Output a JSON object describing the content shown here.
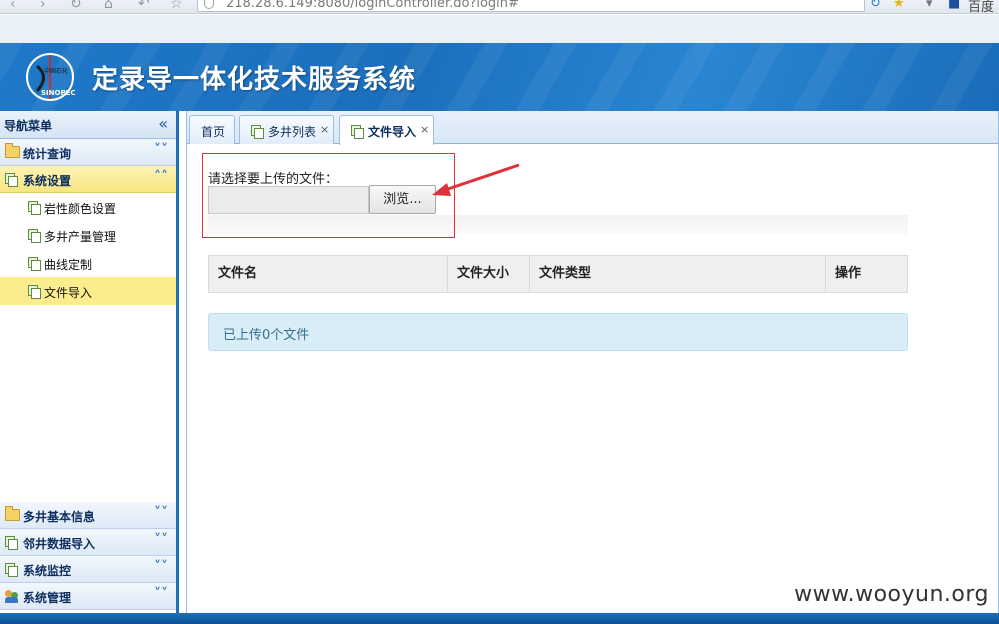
{
  "browser": {
    "url": "218.28.6.149:8080/loginController.do?login#",
    "right_label": "百度"
  },
  "header": {
    "title": "定录导一体化技术服务系统",
    "logo_text": "SINOPEC"
  },
  "sidebar": {
    "title": "导航菜单",
    "collapse_icon": "double-chevron-left-icon",
    "panels": [
      {
        "label": "统计查询",
        "icon": "folder-icon",
        "expanded": false
      },
      {
        "label": "系统设置",
        "icon": "pages-icon",
        "expanded": true,
        "items": [
          {
            "label": "岩性颜色设置",
            "active": false
          },
          {
            "label": "多井产量管理",
            "active": false
          },
          {
            "label": "曲线定制",
            "active": false
          },
          {
            "label": "文件导入",
            "active": true
          }
        ]
      }
    ],
    "bottom_panels": [
      {
        "label": "多井基本信息",
        "icon": "folder-icon"
      },
      {
        "label": "邻井数据导入",
        "icon": "pages-icon"
      },
      {
        "label": "系统监控",
        "icon": "pages-icon"
      },
      {
        "label": "系统管理",
        "icon": "users-icon"
      }
    ]
  },
  "tabs": [
    {
      "label": "首页",
      "closable": false,
      "active": false
    },
    {
      "label": "多井列表",
      "closable": true,
      "active": false
    },
    {
      "label": "文件导入",
      "closable": true,
      "active": true
    }
  ],
  "upload": {
    "label": "请选择要上传的文件：",
    "browse_label": "浏览...",
    "file_value": ""
  },
  "table": {
    "columns": [
      "文件名",
      "文件大小",
      "文件类型",
      "操作"
    ]
  },
  "status": "已上传0个文件",
  "watermark": "www.wooyun.org",
  "colors": {
    "header_blue": "#1b6fbd",
    "active_yellow": "#fbec8d",
    "highlight_red": "#e0313a",
    "info_bg": "#d9edf7"
  }
}
